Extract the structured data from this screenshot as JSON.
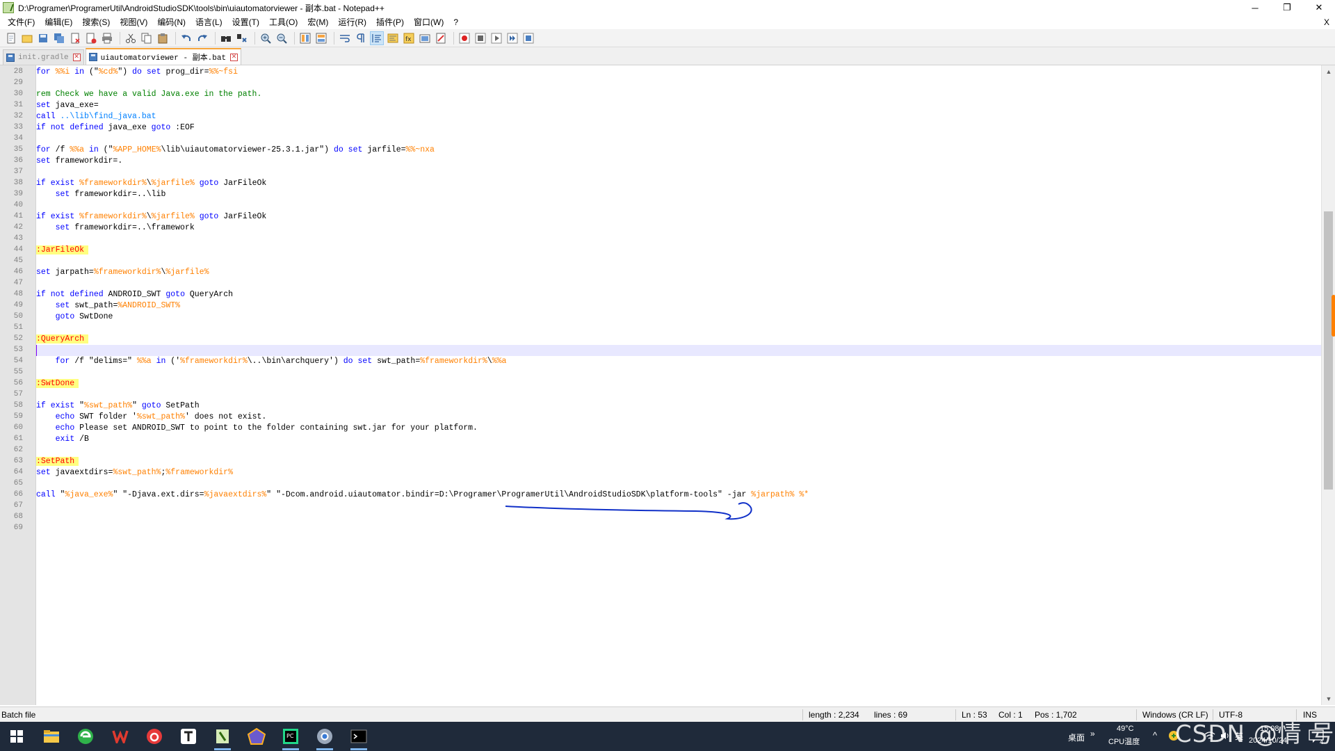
{
  "window": {
    "title": "D:\\Programer\\ProgramerUtil\\AndroidStudioSDK\\tools\\bin\\uiautomatorviewer - 副本.bat - Notepad++",
    "minimize": "─",
    "restore": "❐",
    "close": "✕"
  },
  "menu": {
    "items": [
      "文件(F)",
      "编辑(E)",
      "搜索(S)",
      "视图(V)",
      "编码(N)",
      "语言(L)",
      "设置(T)",
      "工具(O)",
      "宏(M)",
      "运行(R)",
      "插件(P)",
      "窗口(W)",
      "?"
    ],
    "close": "X"
  },
  "toolbar": {
    "icons": [
      "new-file-icon",
      "open-file-icon",
      "save-icon",
      "save-all-icon",
      "close-icon",
      "close-all-icon",
      "print-icon",
      "cut-icon",
      "copy-icon",
      "paste-icon",
      "undo-icon",
      "redo-icon",
      "find-icon",
      "replace-icon",
      "zoom-in-icon",
      "zoom-out-icon",
      "sync-vertical-icon",
      "sync-horizontal-icon",
      "word-wrap-icon",
      "show-all-chars-icon",
      "indent-guide-icon",
      "document-map-icon",
      "function-list-icon",
      "folder-workspace-icon",
      "monitoring-icon",
      "macro-record-icon",
      "macro-stop-icon",
      "macro-play-icon",
      "macro-run-multiple-icon",
      "macro-save-icon"
    ]
  },
  "tabs": [
    {
      "label": "init.gradle",
      "active": false
    },
    {
      "label": "uiautomatorviewer - 副本.bat",
      "active": true
    }
  ],
  "editor": {
    "current_line": 53,
    "lines": [
      {
        "n": "28",
        "parts": [
          [
            "kw",
            "for"
          ],
          [
            "t",
            " "
          ],
          [
            "var",
            "%%i"
          ],
          [
            "t",
            " "
          ],
          [
            "kw",
            "in"
          ],
          [
            "t",
            " (\""
          ],
          [
            "var",
            "%cd%"
          ],
          [
            "t",
            "\") "
          ],
          [
            "kw",
            "do"
          ],
          [
            "t",
            " "
          ],
          [
            "kw",
            "set"
          ],
          [
            "t",
            " prog_dir="
          ],
          [
            "var",
            "%%~fsi"
          ]
        ]
      },
      {
        "n": "29",
        "parts": []
      },
      {
        "n": "30",
        "parts": [
          [
            "cmt",
            "rem Check we have a valid Java.exe in the path."
          ]
        ]
      },
      {
        "n": "31",
        "parts": [
          [
            "kw",
            "set"
          ],
          [
            "t",
            " java_exe="
          ]
        ]
      },
      {
        "n": "32",
        "parts": [
          [
            "kw",
            "call"
          ],
          [
            "t",
            " "
          ],
          [
            "path",
            "..\\lib\\find_java.bat"
          ]
        ]
      },
      {
        "n": "33",
        "parts": [
          [
            "kw",
            "if"
          ],
          [
            "t",
            " "
          ],
          [
            "kw",
            "not"
          ],
          [
            "t",
            " "
          ],
          [
            "kw",
            "defined"
          ],
          [
            "t",
            " java_exe "
          ],
          [
            "kw",
            "goto"
          ],
          [
            "t",
            " :EOF"
          ]
        ]
      },
      {
        "n": "34",
        "parts": []
      },
      {
        "n": "35",
        "parts": [
          [
            "kw",
            "for"
          ],
          [
            "t",
            " /f "
          ],
          [
            "var",
            "%%a"
          ],
          [
            "t",
            " "
          ],
          [
            "kw",
            "in"
          ],
          [
            "t",
            " (\""
          ],
          [
            "var",
            "%APP_HOME%"
          ],
          [
            "t",
            "\\lib\\uiautomatorviewer-25.3.1.jar\") "
          ],
          [
            "kw",
            "do"
          ],
          [
            "t",
            " "
          ],
          [
            "kw",
            "set"
          ],
          [
            "t",
            " jarfile="
          ],
          [
            "var",
            "%%~nxa"
          ]
        ]
      },
      {
        "n": "36",
        "parts": [
          [
            "kw",
            "set"
          ],
          [
            "t",
            " frameworkdir=."
          ]
        ]
      },
      {
        "n": "37",
        "parts": []
      },
      {
        "n": "38",
        "parts": [
          [
            "kw",
            "if"
          ],
          [
            "t",
            " "
          ],
          [
            "kw",
            "exist"
          ],
          [
            "t",
            " "
          ],
          [
            "var",
            "%frameworkdir%"
          ],
          [
            "t",
            "\\"
          ],
          [
            "var",
            "%jarfile%"
          ],
          [
            "t",
            " "
          ],
          [
            "kw",
            "goto"
          ],
          [
            "t",
            " JarFileOk"
          ]
        ]
      },
      {
        "n": "39",
        "parts": [
          [
            "t",
            "    "
          ],
          [
            "kw",
            "set"
          ],
          [
            "t",
            " frameworkdir=..\\lib"
          ]
        ]
      },
      {
        "n": "40",
        "parts": []
      },
      {
        "n": "41",
        "parts": [
          [
            "kw",
            "if"
          ],
          [
            "t",
            " "
          ],
          [
            "kw",
            "exist"
          ],
          [
            "t",
            " "
          ],
          [
            "var",
            "%frameworkdir%"
          ],
          [
            "t",
            "\\"
          ],
          [
            "var",
            "%jarfile%"
          ],
          [
            "t",
            " "
          ],
          [
            "kw",
            "goto"
          ],
          [
            "t",
            " JarFileOk"
          ]
        ]
      },
      {
        "n": "42",
        "parts": [
          [
            "t",
            "    "
          ],
          [
            "kw",
            "set"
          ],
          [
            "t",
            " frameworkdir=..\\framework"
          ]
        ]
      },
      {
        "n": "43",
        "parts": []
      },
      {
        "n": "44",
        "parts": [
          [
            "lbl",
            ":JarFileOk"
          ]
        ]
      },
      {
        "n": "45",
        "parts": []
      },
      {
        "n": "46",
        "parts": [
          [
            "kw",
            "set"
          ],
          [
            "t",
            " jarpath="
          ],
          [
            "var",
            "%frameworkdir%"
          ],
          [
            "t",
            "\\"
          ],
          [
            "var",
            "%jarfile%"
          ]
        ]
      },
      {
        "n": "47",
        "parts": []
      },
      {
        "n": "48",
        "parts": [
          [
            "kw",
            "if"
          ],
          [
            "t",
            " "
          ],
          [
            "kw",
            "not"
          ],
          [
            "t",
            " "
          ],
          [
            "kw",
            "defined"
          ],
          [
            "t",
            " ANDROID_SWT "
          ],
          [
            "kw",
            "goto"
          ],
          [
            "t",
            " QueryArch"
          ]
        ]
      },
      {
        "n": "49",
        "parts": [
          [
            "t",
            "    "
          ],
          [
            "kw",
            "set"
          ],
          [
            "t",
            " swt_path="
          ],
          [
            "var",
            "%ANDROID_SWT%"
          ]
        ]
      },
      {
        "n": "50",
        "parts": [
          [
            "t",
            "    "
          ],
          [
            "kw",
            "goto"
          ],
          [
            "t",
            " SwtDone"
          ]
        ]
      },
      {
        "n": "51",
        "parts": []
      },
      {
        "n": "52",
        "parts": [
          [
            "lbl",
            ":QueryArch"
          ]
        ]
      },
      {
        "n": "53",
        "parts": []
      },
      {
        "n": "54",
        "parts": [
          [
            "t",
            "    "
          ],
          [
            "kw",
            "for"
          ],
          [
            "t",
            " /f \"delims=\" "
          ],
          [
            "var",
            "%%a"
          ],
          [
            "t",
            " "
          ],
          [
            "kw",
            "in"
          ],
          [
            "t",
            " ('"
          ],
          [
            "var",
            "%frameworkdir%"
          ],
          [
            "t",
            "\\..\\bin\\archquery') "
          ],
          [
            "kw",
            "do"
          ],
          [
            "t",
            " "
          ],
          [
            "kw",
            "set"
          ],
          [
            "t",
            " swt_path="
          ],
          [
            "var",
            "%frameworkdir%"
          ],
          [
            "t",
            "\\"
          ],
          [
            "var",
            "%%a"
          ]
        ]
      },
      {
        "n": "55",
        "parts": []
      },
      {
        "n": "56",
        "parts": [
          [
            "lbl",
            ":SwtDone"
          ]
        ]
      },
      {
        "n": "57",
        "parts": []
      },
      {
        "n": "58",
        "parts": [
          [
            "kw",
            "if"
          ],
          [
            "t",
            " "
          ],
          [
            "kw",
            "exist"
          ],
          [
            "t",
            " \""
          ],
          [
            "var",
            "%swt_path%"
          ],
          [
            "t",
            "\" "
          ],
          [
            "kw",
            "goto"
          ],
          [
            "t",
            " SetPath"
          ]
        ]
      },
      {
        "n": "59",
        "parts": [
          [
            "t",
            "    "
          ],
          [
            "kw",
            "echo"
          ],
          [
            "t",
            " SWT folder '"
          ],
          [
            "var",
            "%swt_path%"
          ],
          [
            "t",
            "' does not exist."
          ]
        ]
      },
      {
        "n": "60",
        "parts": [
          [
            "t",
            "    "
          ],
          [
            "kw",
            "echo"
          ],
          [
            "t",
            " Please set ANDROID_SWT to point to the folder containing swt.jar for your platform."
          ]
        ]
      },
      {
        "n": "61",
        "parts": [
          [
            "t",
            "    "
          ],
          [
            "kw",
            "exit"
          ],
          [
            "t",
            " /B"
          ]
        ]
      },
      {
        "n": "62",
        "parts": []
      },
      {
        "n": "63",
        "parts": [
          [
            "lbl",
            ":SetPath"
          ]
        ]
      },
      {
        "n": "64",
        "parts": [
          [
            "kw",
            "set"
          ],
          [
            "t",
            " javaextdirs="
          ],
          [
            "var",
            "%swt_path%"
          ],
          [
            "t",
            ";"
          ],
          [
            "var",
            "%frameworkdir%"
          ]
        ]
      },
      {
        "n": "65",
        "parts": []
      },
      {
        "n": "66",
        "parts": [
          [
            "kw",
            "call"
          ],
          [
            "t",
            " \""
          ],
          [
            "var",
            "%java_exe%"
          ],
          [
            "t",
            "\" \"-Djava.ext.dirs="
          ],
          [
            "var",
            "%javaextdirs%"
          ],
          [
            "t",
            "\" \"-Dcom.android.uiautomator.bindir=D:\\Programer\\ProgramerUtil\\AndroidStudioSDK\\platform-tools\" -jar "
          ],
          [
            "var",
            "%jarpath%"
          ],
          [
            "t",
            " "
          ],
          [
            "var",
            "%*"
          ]
        ]
      },
      {
        "n": "67",
        "parts": []
      },
      {
        "n": "68",
        "parts": []
      },
      {
        "n": "69",
        "parts": []
      }
    ]
  },
  "scrollbar": {
    "up": "▲",
    "down": "▼"
  },
  "status": {
    "language": "Batch file",
    "length": "length : 2,234",
    "lines": "lines : 69",
    "ln": "Ln : 53",
    "col": "Col : 1",
    "pos": "Pos : 1,702",
    "eol": "Windows (CR LF)",
    "encoding": "UTF-8",
    "mode": "INS"
  },
  "taskbar": {
    "apps": [
      "windows-start-icon",
      "file-explorer-icon",
      "browser-icon",
      "wps-office-icon",
      "netease-music-icon",
      "typora-icon",
      "notepadpp-icon",
      "geogebra-icon",
      "pycharm-icon",
      "chrome-icon",
      "terminal-icon"
    ],
    "desktop_label": "桌面",
    "chevron": "»",
    "temp": "49°C",
    "temp_label": "CPU温度",
    "tray_chevron": "^",
    "ime": "英",
    "time": "15:08",
    "date": "2024/10/24",
    "notification_count": "4",
    "watermark": "CSDN @情 号"
  },
  "colors": {
    "keyword": "#0000ff",
    "variable": "#ff8000",
    "label_bg": "#ffff80",
    "label_fg": "#ff0000",
    "comment": "#008000",
    "path": "#0080ff",
    "current_line": "#e8e8ff",
    "ink_annotation": "#0000cc"
  }
}
